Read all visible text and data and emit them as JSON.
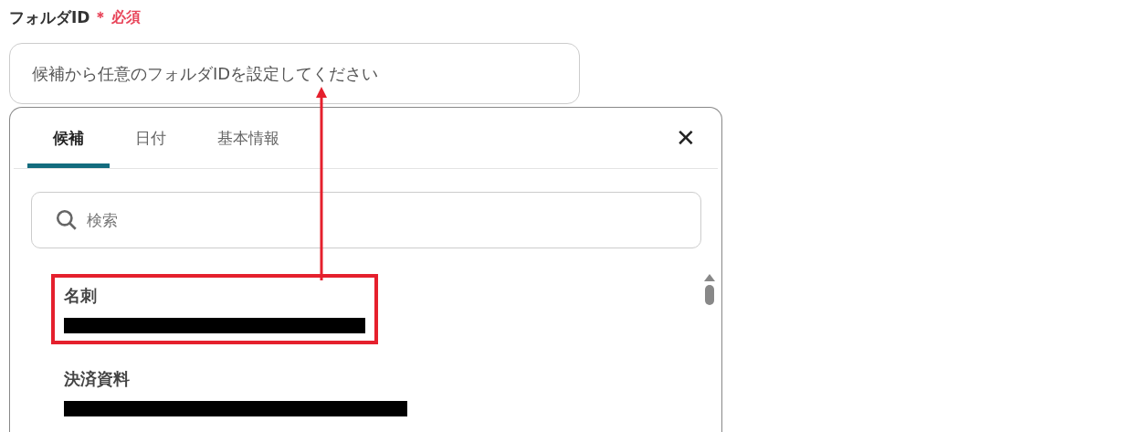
{
  "field": {
    "label": "フォルダID",
    "required_mark": "＊",
    "required_text": "必須",
    "placeholder": "候補から任意のフォルダIDを設定してください"
  },
  "dropdown": {
    "tabs": [
      {
        "label": "候補",
        "selected": true
      },
      {
        "label": "日付",
        "selected": false
      },
      {
        "label": "基本情報",
        "selected": false
      }
    ],
    "close": "✕",
    "search": {
      "placeholder": "検索"
    },
    "items": [
      {
        "title": "名刺",
        "highlighted": true
      },
      {
        "title": "決済資料",
        "highlighted": false
      }
    ]
  }
}
